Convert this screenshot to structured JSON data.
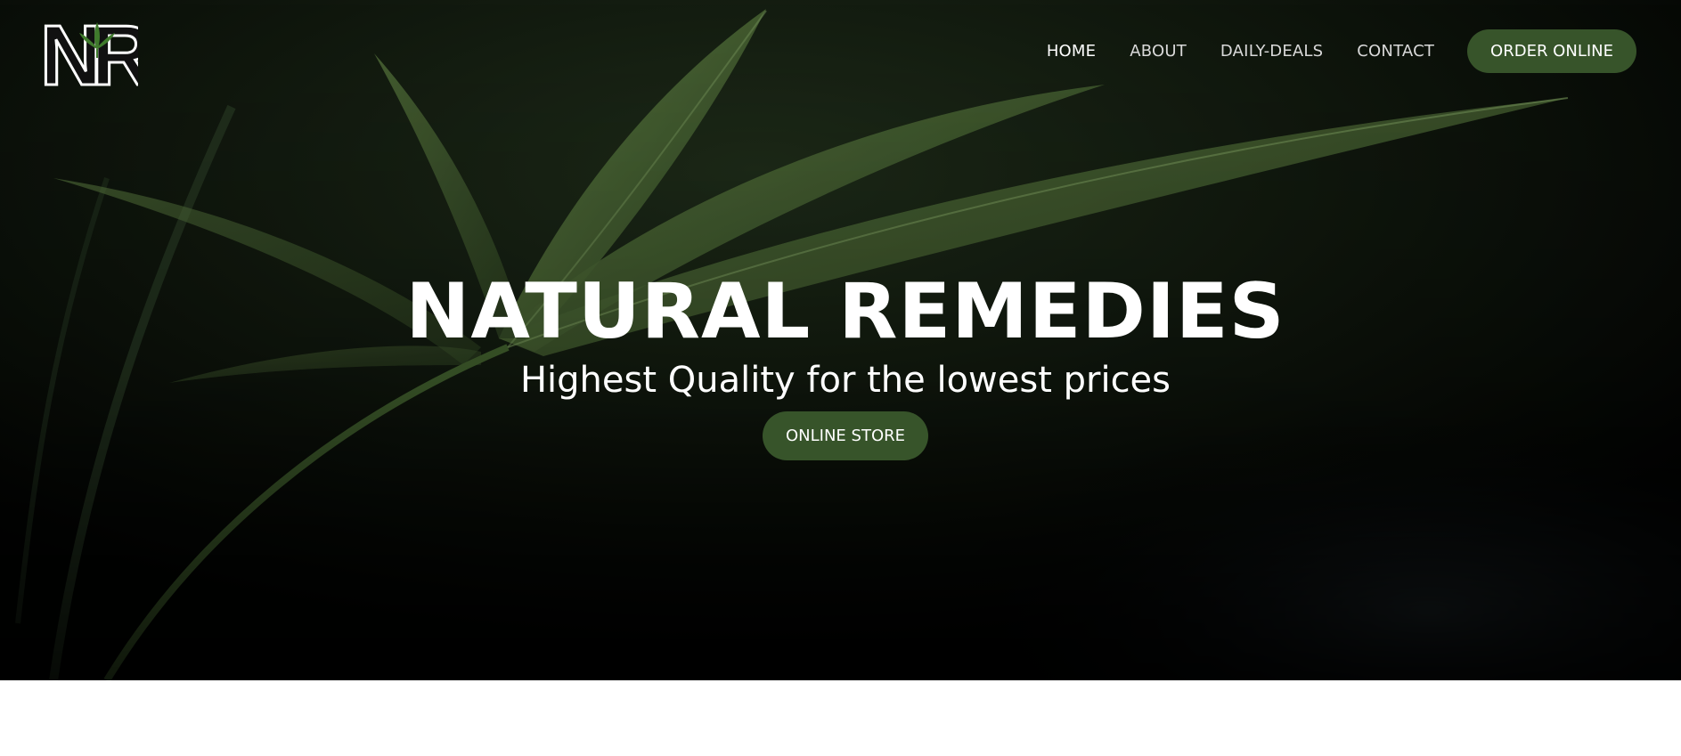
{
  "colors": {
    "accent": "#37542a",
    "hero_bg": "#050705",
    "leaf": "#4e6b37",
    "text": "#ffffff",
    "nav_text": "#d9d9d9"
  },
  "logo": {
    "letters": "NR",
    "icon": "cannabis-leaf-icon"
  },
  "nav": {
    "items": [
      {
        "label": "HOME",
        "active": true
      },
      {
        "label": "ABOUT",
        "active": false
      },
      {
        "label": "DAILY-DEALS",
        "active": false
      },
      {
        "label": "CONTACT",
        "active": false
      }
    ],
    "cta_label": "ORDER ONLINE"
  },
  "hero": {
    "title": "NATURAL REMEDIES",
    "subtitle": "Highest Quality for the lowest prices",
    "button_label": "ONLINE STORE"
  }
}
